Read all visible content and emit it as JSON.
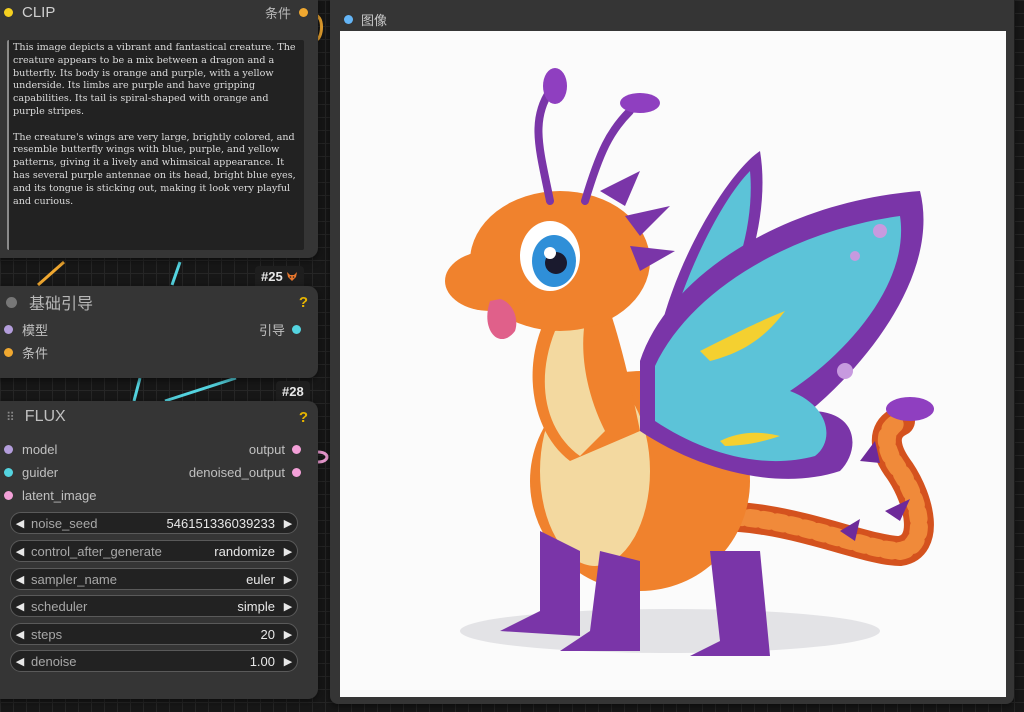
{
  "clip_node": {
    "title": "CLIP",
    "output_label": "条件",
    "prompt_text": "This image depicts a vibrant and fantastical creature. The creature appears to be a mix between a dragon and a butterfly. Its body is orange and purple, with a yellow underside. Its limbs are purple and have gripping capabilities. Its tail is spiral-shaped with orange and purple stripes.\n\nThe creature's wings are very large, brightly colored, and resemble butterfly wings with blue, purple, and yellow patterns, giving it a lively and whimsical appearance. It has several purple antennae on its head, bright blue eyes, and its tongue is sticking out, making it look very playful and curious."
  },
  "guide_node": {
    "badge": "#25",
    "badge_icon": "fox-icon",
    "title": "基础引导",
    "help": "?",
    "inputs": [
      "模型",
      "条件"
    ],
    "output": "引导"
  },
  "flux_node": {
    "badge": "#28",
    "title": "FLUX",
    "help": "?",
    "inputs": [
      "model",
      "guider",
      "latent_image"
    ],
    "outputs": [
      "output",
      "denoised_output"
    ],
    "widgets": [
      {
        "label": "noise_seed",
        "value": "546151336039233"
      },
      {
        "label": "control_after_generate",
        "value": "randomize"
      },
      {
        "label": "sampler_name",
        "value": "euler"
      },
      {
        "label": "scheduler",
        "value": "simple"
      },
      {
        "label": "steps",
        "value": "20"
      },
      {
        "label": "denoise",
        "value": "1.00"
      }
    ]
  },
  "image_node": {
    "title": "图像",
    "image_description": "dragon-butterfly-creature"
  },
  "colors": {
    "conditioning": "#f0a830",
    "clip": "#f5d020",
    "model": "#b39ddb",
    "guider": "#54d4e0",
    "latent": "#f3a0d8",
    "image": "#64b5f6",
    "help": "#e6b400"
  }
}
